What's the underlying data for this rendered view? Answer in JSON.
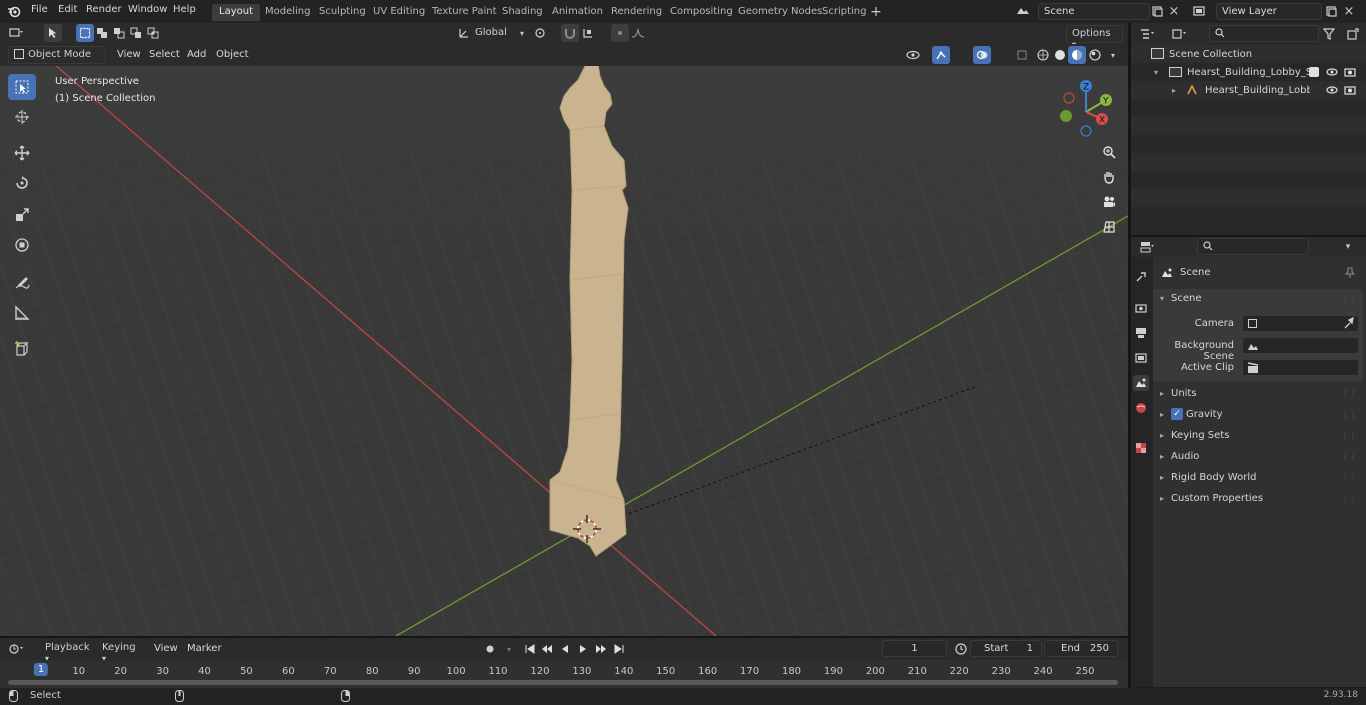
{
  "topbar": {
    "menus": [
      "File",
      "Edit",
      "Render",
      "Window",
      "Help"
    ],
    "workspaces": [
      "Layout",
      "Modeling",
      "Sculpting",
      "UV Editing",
      "Texture Paint",
      "Shading",
      "Animation",
      "Rendering",
      "Compositing",
      "Geometry Nodes",
      "Scripting"
    ],
    "active_workspace": "Layout",
    "scene_name": "Scene",
    "view_layer": "View Layer"
  },
  "tool_header": {
    "orientation": "Global",
    "options_label": "Options"
  },
  "viewport_header": {
    "mode": "Object Mode",
    "menus": [
      "View",
      "Select",
      "Add",
      "Object"
    ]
  },
  "viewport": {
    "perspective_label": "User Perspective",
    "collection_label": "(1) Scene Collection",
    "gizmo_axes": [
      "Z",
      "Y",
      "X"
    ]
  },
  "outliner": {
    "root": "Scene Collection",
    "items": [
      {
        "label": "Hearst_Building_Lobby_Statu"
      },
      {
        "label": "Hearst_Building_Lobby_S"
      }
    ]
  },
  "properties": {
    "context_title": "Scene",
    "section": "Scene",
    "fields": [
      {
        "label": "Camera"
      },
      {
        "label": "Background Scene"
      },
      {
        "label": "Active Clip"
      }
    ],
    "panels": [
      "Units",
      "Gravity",
      "Keying Sets",
      "Audio",
      "Rigid Body World",
      "Custom Properties"
    ],
    "gravity_checked": true
  },
  "timeline": {
    "menus": [
      "Playback",
      "Keying",
      "View",
      "Marker"
    ],
    "current_frame": "1",
    "start_label": "Start",
    "start_value": "1",
    "end_label": "End",
    "end_value": "250",
    "ticks": [
      "1",
      "10",
      "20",
      "30",
      "40",
      "50",
      "60",
      "70",
      "80",
      "90",
      "100",
      "110",
      "120",
      "130",
      "140",
      "150",
      "160",
      "170",
      "180",
      "190",
      "200",
      "210",
      "220",
      "230",
      "240",
      "250"
    ]
  },
  "statusbar": {
    "left_label": "Select",
    "version": "2.93.18"
  },
  "colors": {
    "accent": "#4772b3",
    "x_axis": "#c4453e",
    "y_axis": "#6c9a2c",
    "model": "#c9b48f"
  }
}
